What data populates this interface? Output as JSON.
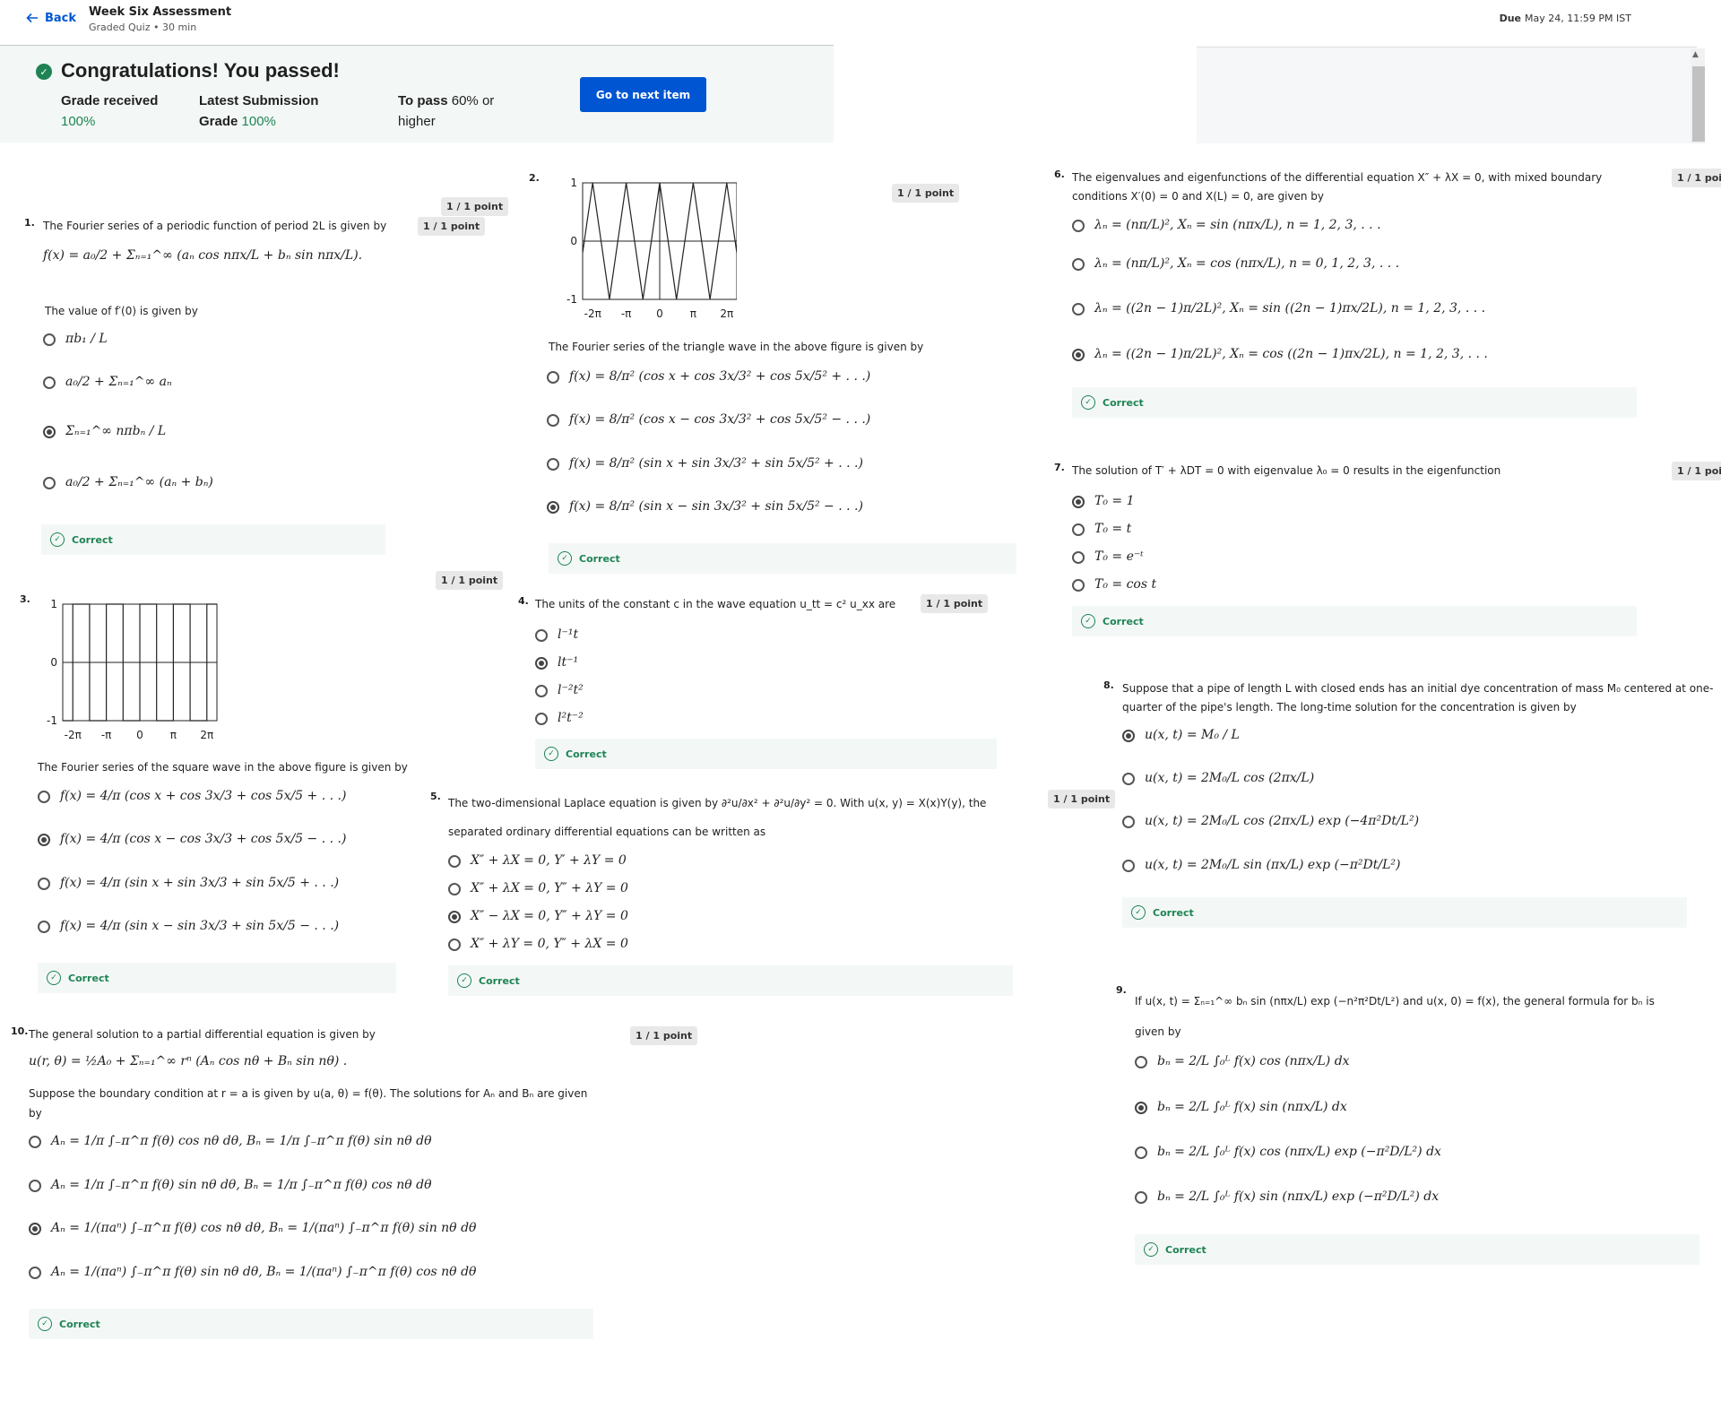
{
  "header": {
    "back": "Back",
    "title": "Week Six Assessment",
    "subtitle": "Graded Quiz • 30 min",
    "due_label": "Due",
    "due_value": "May 24, 11:59 PM IST"
  },
  "result": {
    "title": "Congratulations! You passed!",
    "grade_label": "Grade received",
    "grade_value": "100%",
    "latest_label": "Latest Submission Grade",
    "latest_value": "100%",
    "topass_label": "To pass",
    "topass_value": "60% or higher",
    "next_button": "Go to next item"
  },
  "correct_label": "Correct",
  "questions": [
    {
      "num": "1.",
      "points": "1 / 1 point",
      "text": "The Fourier series of a periodic function of period 2L is given by",
      "formula": "f(x) = a₀/2 + Σₙ₌₁^∞ (aₙ cos nπx/L + bₙ sin nπx/L).",
      "subtext": "The value of f′(0) is given by",
      "options": [
        "πb₁ / L",
        "a₀/2 + Σₙ₌₁^∞ aₙ",
        "Σₙ₌₁^∞ nπbₙ / L",
        "a₀/2 + Σₙ₌₁^∞ (aₙ + bₙ)"
      ],
      "selected": 2
    },
    {
      "num": "2.",
      "points": "1 / 1 point",
      "text": "The Fourier series of the triangle wave in the above figure is given by",
      "options": [
        "f(x) = 8/π² (cos x + cos 3x/3² + cos 5x/5² + . . .)",
        "f(x) = 8/π² (cos x − cos 3x/3² + cos 5x/5² − . . .)",
        "f(x) = 8/π² (sin x + sin 3x/3² + sin 5x/5² + . . .)",
        "f(x) = 8/π² (sin x − sin 3x/3² + sin 5x/5² − . . .)"
      ],
      "selected": 3
    },
    {
      "num": "3.",
      "points": "1 / 1 point",
      "text": "The Fourier series of the square wave in the  above figure is given by",
      "options": [
        "f(x) = 4/π (cos x + cos 3x/3 + cos 5x/5 + . . .)",
        "f(x) = 4/π (cos x − cos 3x/3 + cos 5x/5 − . . .)",
        "f(x) = 4/π (sin x + sin 3x/3 + sin 5x/5 + . . .)",
        "f(x) = 4/π (sin x − sin 3x/3 + sin 5x/5 − . . .)"
      ],
      "selected": 1
    },
    {
      "num": "4.",
      "points": "1 / 1 point",
      "text": "The units of the constant c in the wave equation u_tt = c² u_xx are",
      "options": [
        "l⁻¹t",
        "lt⁻¹",
        "l⁻²t²",
        "l²t⁻²"
      ],
      "selected": 1
    },
    {
      "num": "5.",
      "points": "1 / 1 point",
      "text": "The two-dimensional Laplace equation is given by ∂²u/∂x² + ∂²u/∂y² = 0. With u(x, y) = X(x)Y(y), the",
      "text2": "separated ordinary differential equations can be written as",
      "options": [
        "X″ + λX = 0,    Y′ + λY = 0",
        "X″ + λX = 0,    Y″ + λY = 0",
        "X″ − λX = 0,    Y″ + λY = 0",
        "X″ + λY = 0,    Y″ + λX = 0"
      ],
      "selected": 2
    },
    {
      "num": "6.",
      "points": "1 / 1 point",
      "text": "The eigenvalues and eigenfunctions of the differential equation X″ + λX = 0, with mixed boundary",
      "text2": "conditions X′(0) = 0 and X(L) = 0, are given by",
      "options": [
        "λₙ = (nπ/L)²,   Xₙ = sin (nπx/L),   n = 1, 2, 3, . . .",
        "λₙ = (nπ/L)²,   Xₙ = cos (nπx/L),   n = 0, 1, 2, 3, . . .",
        "λₙ = ((2n − 1)π/2L)²,   Xₙ = sin ((2n − 1)πx/2L),   n = 1, 2, 3, . . .",
        "λₙ = ((2n − 1)π/2L)²,   Xₙ = cos ((2n − 1)πx/2L),   n = 1, 2, 3, . . ."
      ],
      "selected": 3
    },
    {
      "num": "7.",
      "points": "1 / 1 point",
      "text": "The solution of T′ + λDT = 0 with eigenvalue λ₀ = 0 results in the eigenfunction",
      "options": [
        "T₀ = 1",
        "T₀ = t",
        "T₀ = e⁻ᵗ",
        "T₀ = cos t"
      ],
      "selected": 0
    },
    {
      "num": "8.",
      "points": "1 / 1 point",
      "text": "Suppose that a pipe of length L with closed ends has an initial dye concentration of  mass M₀ centered at one-",
      "text2": "quarter of the pipe's length.  The  long-time solution for the concentration is given by",
      "options": [
        "u(x, t) = M₀ / L",
        "u(x, t) = 2M₀/L cos (2πx/L)",
        "u(x, t) = 2M₀/L cos (2πx/L) exp (−4π²Dt/L²)",
        "u(x, t) = 2M₀/L sin (πx/L) exp (−π²Dt/L²)"
      ],
      "selected": 0
    },
    {
      "num": "9.",
      "text": "If u(x, t) = Σₙ₌₁^∞ bₙ sin (nπx/L) exp (−n²π²Dt/L²) and u(x, 0) = f(x), the general formula for bₙ is",
      "text2": "given by",
      "options": [
        "bₙ = 2/L ∫₀ᴸ f(x) cos (nπx/L) dx",
        "bₙ = 2/L ∫₀ᴸ f(x) sin (nπx/L) dx",
        "bₙ = 2/L ∫₀ᴸ f(x) cos (nπx/L) exp (−π²D/L²) dx",
        "bₙ = 2/L ∫₀ᴸ f(x) sin (nπx/L) exp (−π²D/L²) dx"
      ],
      "selected": 1
    },
    {
      "num": "10.",
      "points": "1 / 1 point",
      "text": "The general solution to a partial differential equation is given by",
      "formula": "u(r, θ) = ½A₀ + Σₙ₌₁^∞ rⁿ (Aₙ cos nθ + Bₙ sin nθ) .",
      "subtext": "Suppose the boundary condition at r = a is given by u(a, θ) = f(θ).  The solutions for Aₙ and Bₙ are given",
      "subtext2": "by",
      "options": [
        "Aₙ = 1/π ∫₋π^π f(θ) cos nθ dθ,    Bₙ = 1/π ∫₋π^π f(θ) sin nθ dθ",
        "Aₙ = 1/π ∫₋π^π f(θ) sin nθ dθ,    Bₙ = 1/π ∫₋π^π f(θ) cos nθ dθ",
        "Aₙ = 1/(πaⁿ) ∫₋π^π f(θ) cos nθ dθ,    Bₙ = 1/(πaⁿ) ∫₋π^π f(θ) sin nθ dθ",
        "Aₙ = 1/(πaⁿ) ∫₋π^π f(θ) sin nθ dθ,    Bₙ = 1/(πaⁿ) ∫₋π^π f(θ) cos nθ dθ"
      ],
      "selected": 2
    }
  ],
  "extra_points": "1 / 1 point",
  "figures": {
    "y_ticks": [
      "1",
      "0",
      "-1"
    ],
    "x_ticks": [
      "-2π",
      "-π",
      "0",
      "π",
      "2π"
    ]
  }
}
